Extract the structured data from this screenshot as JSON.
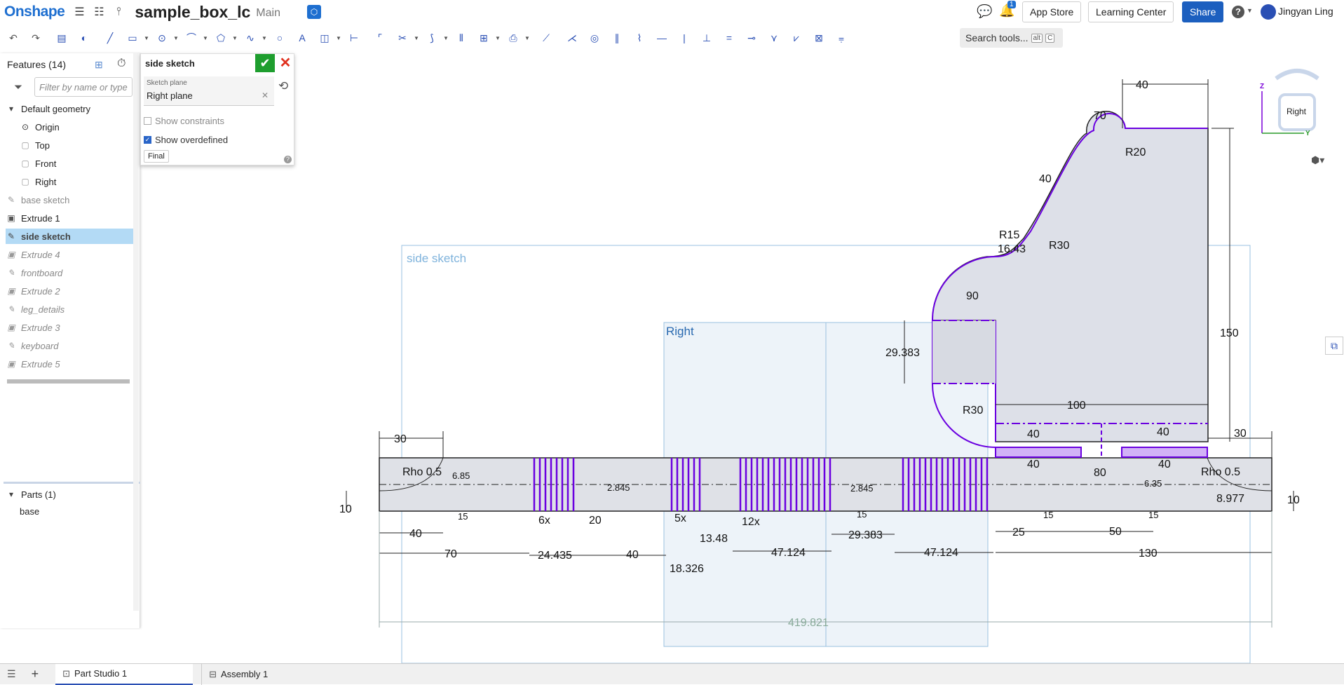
{
  "topbar": {
    "logo": "Onshape",
    "doc_title": "sample_box_lc",
    "branch": "Main",
    "notification_count": "1",
    "app_store": "App Store",
    "learning_center": "Learning Center",
    "share": "Share",
    "help": "?",
    "user_name": "Jingyan Ling"
  },
  "toolbar": {
    "search_placeholder": "Search tools...",
    "search_kbd1": "alt",
    "search_kbd2": "C"
  },
  "features": {
    "header": "Features (14)",
    "filter_placeholder": "Filter by name or type",
    "items": [
      {
        "label": "Default geometry"
      },
      {
        "label": "Origin"
      },
      {
        "label": "Top"
      },
      {
        "label": "Front"
      },
      {
        "label": "Right"
      },
      {
        "label": "base sketch"
      },
      {
        "label": "Extrude 1"
      },
      {
        "label": "side sketch"
      },
      {
        "label": "Extrude 4"
      },
      {
        "label": "frontboard"
      },
      {
        "label": "Extrude 2"
      },
      {
        "label": "leg_details"
      },
      {
        "label": "Extrude 3"
      },
      {
        "label": "keyboard"
      },
      {
        "label": "Extrude 5"
      }
    ]
  },
  "parts": {
    "header": "Parts (1)",
    "items": [
      {
        "label": "base"
      }
    ]
  },
  "sketch_dialog": {
    "title": "side sketch",
    "plane_label": "Sketch plane",
    "plane_value": "Right plane",
    "show_constraints": "Show constraints",
    "show_constraints_checked": false,
    "show_overdefined": "Show overdefined",
    "show_overdefined_checked": true,
    "final_button": "Final"
  },
  "canvas": {
    "sketch_label": "side sketch",
    "plane_label": "Right",
    "dims": {
      "d40_top": "40",
      "d70_angle": "70",
      "r20": "R20",
      "d40_slant": "40",
      "r15": "R15",
      "d16_43": "16.43",
      "r30_top": "R30",
      "d90": "90",
      "d150": "150",
      "d29_383": "29.383",
      "d100": "100",
      "r30_left": "R30",
      "d30_right": "30",
      "d40_a": "40",
      "d40_b": "40",
      "d40_c": "40",
      "d80": "80",
      "d30_left": "30",
      "rho_left": "Rho 0.5",
      "rho_right": "Rho 0.5",
      "d6_85": "6.85",
      "d6_35": "6.35",
      "d2_845_a": "2.845",
      "d2_845_b": "2.845",
      "d10_left": "10",
      "d10_right": "10",
      "d8_977": "8.977",
      "d6x": "6x",
      "d5x": "5x",
      "d12x": "12x",
      "d20": "20",
      "d15_a": "15",
      "d15_b": "15",
      "d15_c": "15",
      "d15_d": "15",
      "d40_bl": "40",
      "d70_b": "70",
      "d24_435": "24.435",
      "d40_d": "40",
      "d13_48": "13.48",
      "d18_326": "18.326",
      "d47_124_a": "47.124",
      "d29_383_b": "29.383",
      "d47_124_b": "47.124",
      "d25": "25",
      "d50": "50",
      "d130": "130",
      "d419_821": "419.821"
    }
  },
  "viewcube": {
    "face": "Right",
    "z": "Z",
    "y": "Y"
  },
  "bottom": {
    "tab1": "Part Studio 1",
    "tab2": "Assembly 1"
  },
  "colors": {
    "brand": "#1e6fd0",
    "share": "#1c5fbf",
    "selection": "#b3daf5",
    "sketch": "#6a00e0",
    "plane": "#9ac0e0"
  }
}
